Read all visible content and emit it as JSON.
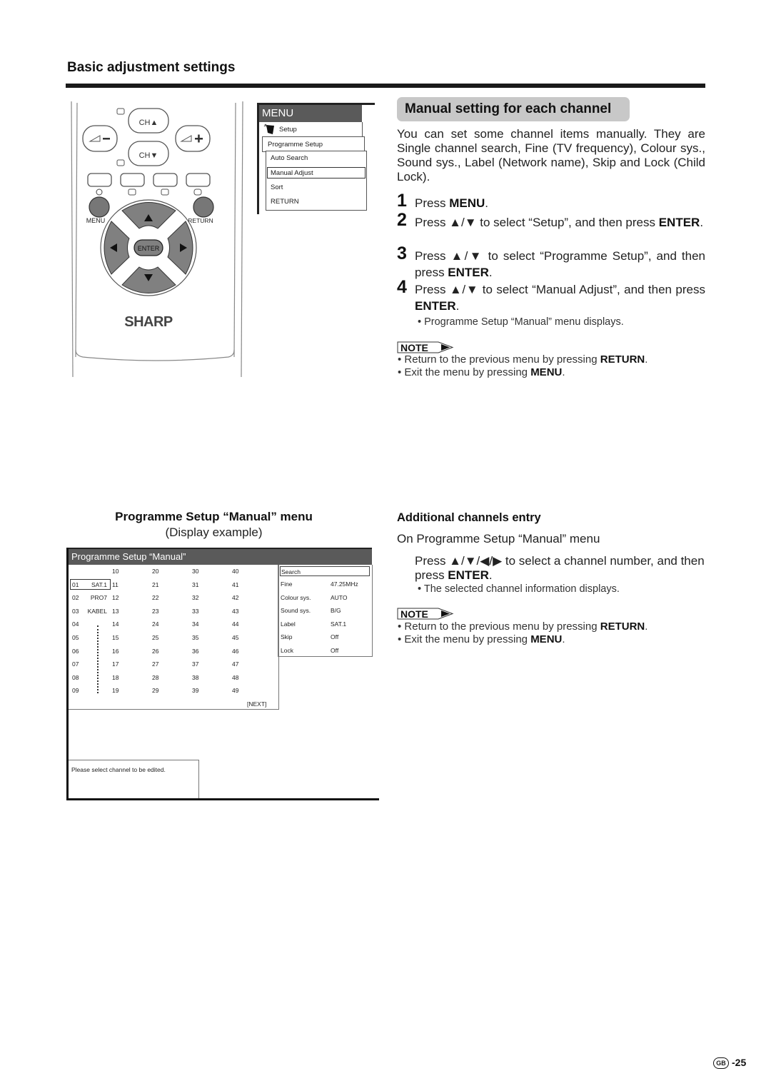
{
  "header": {
    "section_title": "Basic adjustment settings"
  },
  "remote": {
    "brand": "SHARP",
    "ch_up": "CH▲",
    "ch_down": "CH▼",
    "vol_minus": "◿−",
    "vol_plus": "◿+",
    "menu_label": "MENU",
    "return_label": "RETURN",
    "enter_label": "ENTER",
    "up_arrow": "▲",
    "down_arrow": "▼",
    "left_arrow": "◀",
    "right_arrow": "▶"
  },
  "menu_osd": {
    "title": "MENU",
    "setup": "Setup",
    "programme_setup": "Programme Setup",
    "items": [
      "Auto Search",
      "Manual Adjust",
      "Sort",
      "RETURN"
    ],
    "selected": "Manual Adjust"
  },
  "manual_setting": {
    "heading": "Manual setting for each channel",
    "intro": "You can set some channel items manually. They are Single channel search, Fine (TV frequency), Colour sys., Sound sys., Label (Network name), Skip and Lock (Child Lock).",
    "steps": [
      {
        "num": "1",
        "pre": "Press ",
        "bold": "MENU",
        "post": "."
      },
      {
        "num": "2",
        "pre": "Press ▲/▼ to select “Setup”, and then press ",
        "bold": "ENTER",
        "post": "."
      },
      {
        "num": "3",
        "pre": "Press ▲/▼ to select “Programme Setup”, and then press ",
        "bold": "ENTER",
        "post": "."
      },
      {
        "num": "4",
        "pre": "Press ▲/▼ to select “Manual Adjust”, and then press ",
        "bold": "ENTER",
        "post": "."
      }
    ],
    "step4_bullet": "• Programme Setup “Manual” menu displays.",
    "note_label": "NOTE",
    "notes": [
      {
        "pre": "• Return to the previous menu by pressing ",
        "bold": "RETURN",
        "post": "."
      },
      {
        "pre": "• Exit the menu by pressing ",
        "bold": "MENU",
        "post": "."
      }
    ]
  },
  "programme_manual": {
    "title": "Programme Setup “Manual” menu",
    "subtitle": "(Display example)",
    "screen_title": "Programme Setup “Manual”",
    "channels_col0": [
      {
        "num": "01",
        "label": "SAT.1"
      },
      {
        "num": "02",
        "label": "PRO7"
      },
      {
        "num": "03",
        "label": "KABEL"
      },
      {
        "num": "04",
        "label": ""
      },
      {
        "num": "05",
        "label": ""
      },
      {
        "num": "06",
        "label": ""
      },
      {
        "num": "07",
        "label": ""
      },
      {
        "num": "08",
        "label": ""
      },
      {
        "num": "09",
        "label": ""
      }
    ],
    "channels_cols": [
      [
        "10",
        "11",
        "12",
        "13",
        "14",
        "15",
        "16",
        "17",
        "18",
        "19"
      ],
      [
        "20",
        "21",
        "22",
        "23",
        "24",
        "25",
        "26",
        "27",
        "28",
        "29"
      ],
      [
        "30",
        "31",
        "32",
        "33",
        "34",
        "35",
        "36",
        "37",
        "38",
        "39"
      ],
      [
        "40",
        "41",
        "42",
        "43",
        "44",
        "45",
        "46",
        "47",
        "48",
        "49"
      ]
    ],
    "next_label": "[NEXT]",
    "selected_channel": "01",
    "info_search": "Search",
    "info": [
      {
        "key": "Fine",
        "value": "47.25MHz"
      },
      {
        "key": "Colour sys.",
        "value": "AUTO"
      },
      {
        "key": "Sound sys.",
        "value": "B/G"
      },
      {
        "key": "Label",
        "value": "SAT.1"
      },
      {
        "key": "Skip",
        "value": "Off"
      },
      {
        "key": "Lock",
        "value": "Off"
      }
    ],
    "message": "Please select channel to be edited."
  },
  "additional": {
    "title": "Additional channels entry",
    "on_menu": "On Programme Setup “Manual” menu",
    "step_pre": "Press ▲/▼/◀/▶ to select a channel number, and then press ",
    "step_bold": "ENTER",
    "step_post": ".",
    "bullet": "• The selected channel information displays.",
    "note_label": "NOTE",
    "notes": [
      {
        "pre": "• Return to the previous menu by pressing ",
        "bold": "RETURN",
        "post": "."
      },
      {
        "pre": "• Exit the menu by pressing ",
        "bold": "MENU",
        "post": "."
      }
    ]
  },
  "footer": {
    "region": "GB",
    "page": "-25"
  }
}
